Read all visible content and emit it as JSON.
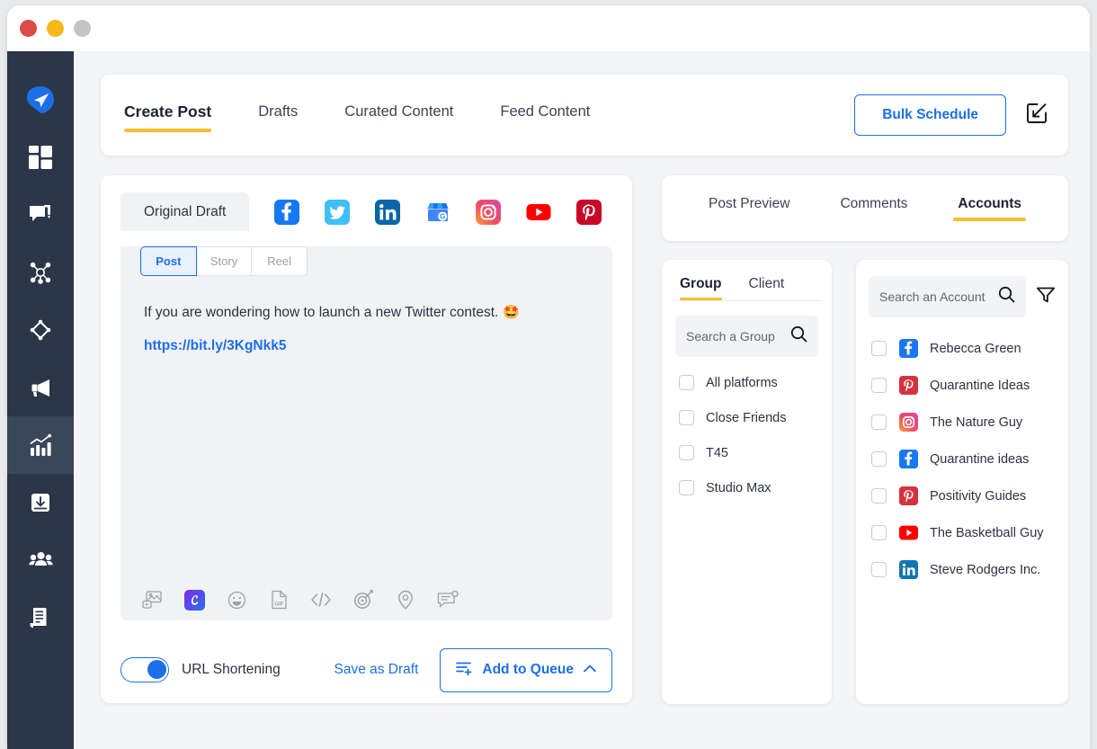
{
  "window": {
    "traffic_lights": [
      "close",
      "minimize",
      "maximize"
    ],
    "colors": {
      "red": "#dd4b47",
      "yellow": "#f8b81a",
      "gray": "#c3c4c6"
    }
  },
  "accent": {
    "yellow": "#f7be34",
    "blue": "#1d6fe8",
    "sidebar": "#2b3648"
  },
  "sidebar": {
    "items": [
      {
        "icon": "send-paper-plane-icon",
        "label": "Publish",
        "active": false,
        "brand": true
      },
      {
        "icon": "dashboard-grid-icon",
        "label": "Dashboard",
        "active": false
      },
      {
        "icon": "engage-comment-icon",
        "label": "Engage",
        "active": false
      },
      {
        "icon": "network-nodes-icon",
        "label": "Network",
        "active": false
      },
      {
        "icon": "diamond-target-icon",
        "label": "Campaigns",
        "active": false
      },
      {
        "icon": "megaphone-icon",
        "label": "Advocacy",
        "active": false
      },
      {
        "icon": "analytics-bar-chart-icon",
        "label": "Analytics",
        "active": true
      },
      {
        "icon": "download-inbox-icon",
        "label": "Downloads",
        "active": false
      },
      {
        "icon": "team-users-icon",
        "label": "Team",
        "active": false
      },
      {
        "icon": "reports-document-icon",
        "label": "Reports",
        "active": false
      }
    ]
  },
  "topbar": {
    "tabs": [
      {
        "label": "Create Post",
        "active": true
      },
      {
        "label": "Drafts",
        "active": false
      },
      {
        "label": "Curated Content",
        "active": false
      },
      {
        "label": "Feed Content",
        "active": false
      }
    ],
    "bulk_schedule_label": "Bulk Schedule",
    "compose_icon": "compose-square-arrow-icon"
  },
  "composer": {
    "draft_tab_label": "Original Draft",
    "platform_icons": [
      {
        "name": "facebook-icon",
        "label": "Facebook"
      },
      {
        "name": "twitter-icon",
        "label": "Twitter"
      },
      {
        "name": "linkedin-icon",
        "label": "LinkedIn"
      },
      {
        "name": "google-business-icon",
        "label": "Google Business Profile"
      },
      {
        "name": "instagram-icon",
        "label": "Instagram"
      },
      {
        "name": "youtube-icon",
        "label": "YouTube"
      },
      {
        "name": "pinterest-icon",
        "label": "Pinterest"
      }
    ],
    "segments": [
      {
        "label": "Post",
        "active": true
      },
      {
        "label": "Story",
        "active": false
      },
      {
        "label": "Reel",
        "active": false
      }
    ],
    "post_text": "If you are wondering how to launch a new Twitter contest.",
    "post_emoji": "🤩",
    "post_link": "https://bit.ly/3KgNkk5",
    "toolbar_icons": [
      {
        "name": "media-image-icon",
        "label": "Add media"
      },
      {
        "name": "canva-icon",
        "label": "Canva"
      },
      {
        "name": "emoji-smiley-icon",
        "label": "Emoji"
      },
      {
        "name": "gif-file-icon",
        "label": "GIF"
      },
      {
        "name": "code-brackets-icon",
        "label": "Code"
      },
      {
        "name": "target-icon",
        "label": "Campaign"
      },
      {
        "name": "location-pin-icon",
        "label": "Location"
      },
      {
        "name": "note-comment-icon",
        "label": "First comment"
      }
    ],
    "footer": {
      "toggle_label": "URL Shortening",
      "toggle_on": true,
      "save_draft_label": "Save as Draft",
      "add_queue_label": "Add to Queue",
      "add_queue_icon": "queue-list-icon",
      "chevron_icon": "chevron-up-icon"
    }
  },
  "right_panel": {
    "tabs": [
      {
        "label": "Post Preview",
        "active": false
      },
      {
        "label": "Comments",
        "active": false
      },
      {
        "label": "Accounts",
        "active": true
      }
    ],
    "group_panel": {
      "tabs": [
        {
          "label": "Group",
          "active": true
        },
        {
          "label": "Client",
          "active": false
        }
      ],
      "search_placeholder": "Search a Group",
      "search_icon": "search-icon",
      "items": [
        {
          "label": "All platforms",
          "checked": false
        },
        {
          "label": "Close Friends",
          "checked": false
        },
        {
          "label": "T45",
          "checked": false
        },
        {
          "label": "Studio Max",
          "checked": false
        }
      ]
    },
    "accounts_panel": {
      "search_placeholder": "Search an Account",
      "search_icon": "search-icon",
      "filter_icon": "filter-funnel-icon",
      "accounts": [
        {
          "label": "Rebecca Green",
          "platform": "facebook-icon",
          "checked": false
        },
        {
          "label": "Quarantine Ideas",
          "platform": "pinterest-icon",
          "checked": false
        },
        {
          "label": "The Nature Guy",
          "platform": "instagram-icon",
          "checked": false
        },
        {
          "label": "Quarantine ideas",
          "platform": "facebook-icon",
          "checked": false
        },
        {
          "label": "Positivity Guides",
          "platform": "pinterest-icon",
          "checked": false
        },
        {
          "label": "The Basketball Guy",
          "platform": "youtube-icon",
          "checked": false
        },
        {
          "label": "Steve Rodgers Inc.",
          "platform": "linkedin-icon",
          "checked": false
        }
      ]
    }
  }
}
